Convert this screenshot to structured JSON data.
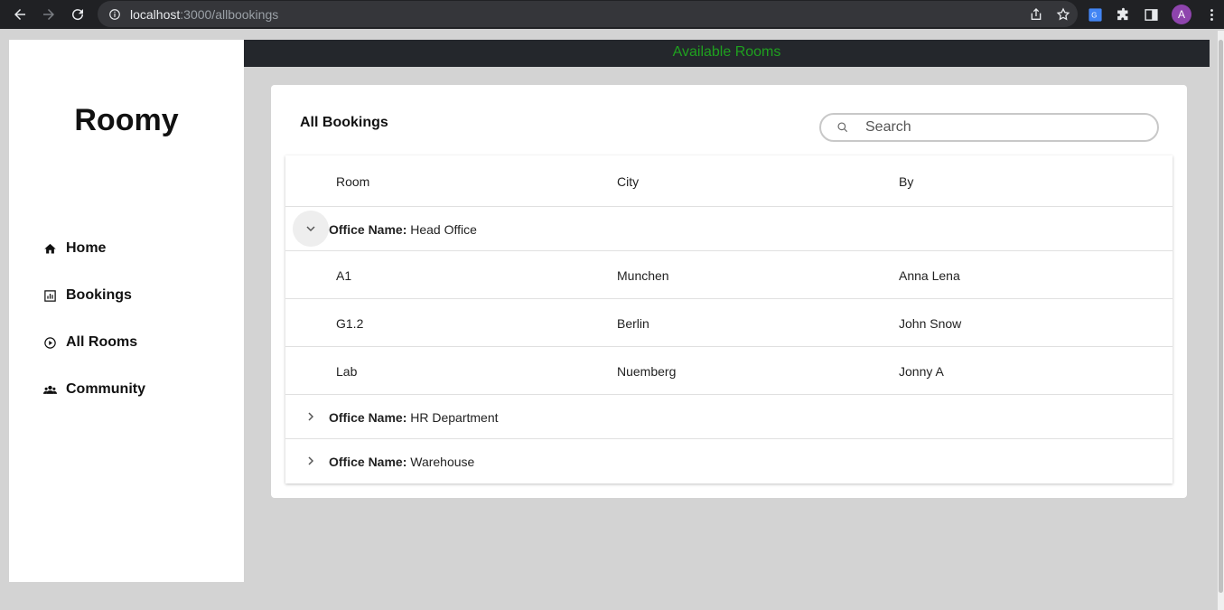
{
  "browser": {
    "url_host": "localhost",
    "url_rest": ":3000/allbookings",
    "avatar_letter": "A"
  },
  "sidebar": {
    "brand": "Roomy",
    "items": [
      {
        "label": "Home",
        "icon": "home-icon"
      },
      {
        "label": "Bookings",
        "icon": "bar-chart-icon"
      },
      {
        "label": "All Rooms",
        "icon": "play-circle-icon"
      },
      {
        "label": "Community",
        "icon": "group-icon"
      }
    ]
  },
  "topbar": {
    "title": "Available Rooms",
    "color": "#1fa01f"
  },
  "main": {
    "title": "All Bookings",
    "search_placeholder": "Search",
    "columns": [
      "Room",
      "City",
      "By"
    ],
    "group_prefix": "Office Name:",
    "groups": [
      {
        "name": "Head Office",
        "expanded": true,
        "rows": [
          {
            "room": "A1",
            "city": "Munchen",
            "by": "Anna Lena"
          },
          {
            "room": "G1.2",
            "city": "Berlin",
            "by": "John Snow"
          },
          {
            "room": "Lab",
            "city": "Nuemberg",
            "by": "Jonny A"
          }
        ]
      },
      {
        "name": "HR Department",
        "expanded": false
      },
      {
        "name": "Warehouse",
        "expanded": false
      }
    ]
  }
}
